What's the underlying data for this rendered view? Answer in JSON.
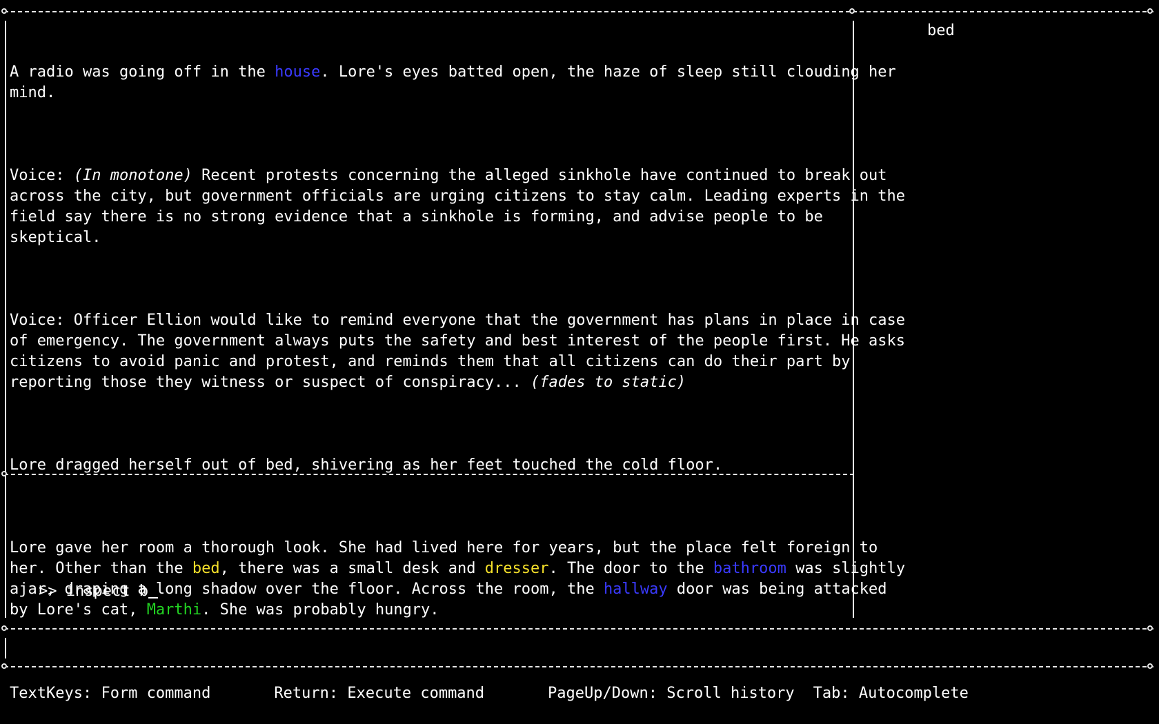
{
  "story": {
    "p1": {
      "before": "A radio was going off in the ",
      "kw": "house",
      "after": ". Lore's eyes batted open, the haze of sleep still clouding her mind."
    },
    "p2": {
      "speaker": "Voice: ",
      "italic": "(In monotone)",
      "text": " Recent protests concerning the alleged sinkhole have continued to break out across the city, but government officials are urging citizens to stay calm. Leading experts in the field say there is no strong evidence that a sinkhole is forming, and advise people to be skeptical."
    },
    "p3": {
      "text": "Voice: Officer Ellion would like to remind everyone that the government has plans in place in case of emergency. The government always puts the safety and best interest of the people first. He asks citizens to avoid panic and protest, and reminds them that all citizens can do their part by reporting those they witness or suspect of conspiracy... ",
      "italic": "(fades to static)"
    },
    "p4": {
      "text": "Lore dragged herself out of bed, shivering as her feet touched the cold floor."
    },
    "p5": {
      "t1": "Lore gave her room a thorough look. She had lived here for years, but the place felt foreign to her. Other than the ",
      "kw_bed": "bed",
      "t2": ", there was a small desk and ",
      "kw_dresser": "dresser",
      "t3": ". The door to the ",
      "kw_bathroom": "bathroom",
      "t4": " was slightly ajar, draping a long shadow over the floor. Across the room, the ",
      "kw_hallway": "hallway",
      "t5": " door was being attacked by Lore's cat, ",
      "kw_marthi": "Marthi",
      "t6": ". She was probably hungry."
    }
  },
  "sidebar": {
    "suggestions": [
      "bed"
    ]
  },
  "input": {
    "prompt": ">> ",
    "value": "inspect b"
  },
  "statusbar": {
    "hint1": "TextKeys: Form command",
    "hint2": "Return: Execute command",
    "hint3": "PageUp/Down: Scroll history",
    "hint4": "Tab: Autocomplete"
  },
  "colors": {
    "location": "#3a3aff",
    "item": "#f5e02a",
    "character": "#22d322",
    "text": "#ffffff",
    "background": "#000000"
  }
}
